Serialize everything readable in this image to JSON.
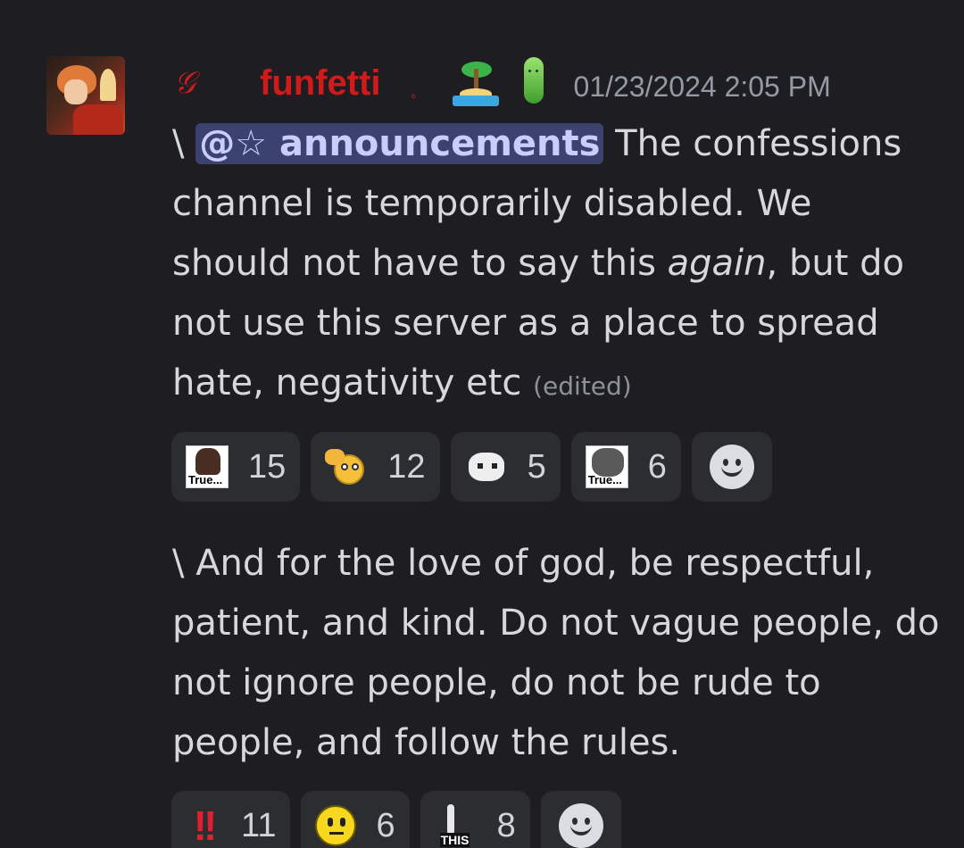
{
  "message": {
    "role_glyph": "𝒢",
    "username": "funfetti",
    "username_color": "#d11a1a",
    "separator_dot": "。",
    "badges": [
      "palm-tree-island-icon",
      "pickle-icon"
    ],
    "timestamp": "01/23/2024 2:05 PM",
    "paragraph1": {
      "prefix": "\\ ",
      "mention": "@☆ announcements",
      "text_before_italic": " The confessions channel is temporarily disabled. We should not have to say this ",
      "italic": "again",
      "text_after_italic": ", but do not use this server as a place to spread hate, negativity etc ",
      "edited_label": "(edited)"
    },
    "reactions1": [
      {
        "emoji": "true-meme-emoji",
        "label": "True...",
        "count": "15"
      },
      {
        "emoji": "thumbs-up-smiley-emoji",
        "count": "12"
      },
      {
        "emoji": "white-cat-emoji",
        "count": "5"
      },
      {
        "emoji": "true-cat-emoji",
        "label": "True...",
        "count": "6"
      }
    ],
    "paragraph2": "\\ And for the love of god, be respectful, patient, and kind. Do not vague people, do not ignore people, do not be rude to people, and follow the rules.",
    "reactions2": [
      {
        "emoji": "double-exclamation-emoji",
        "glyph": "!!",
        "count": "11"
      },
      {
        "emoji": "neutral-face-emoji",
        "count": "6"
      },
      {
        "emoji": "this-emoji",
        "label": "THIS",
        "count": "8"
      }
    ],
    "colors": {
      "background": "#1d1d22",
      "mention_bg": "#3c4270",
      "mention_text": "#c9cdfb",
      "reaction_bg": "#2b2d31"
    }
  }
}
